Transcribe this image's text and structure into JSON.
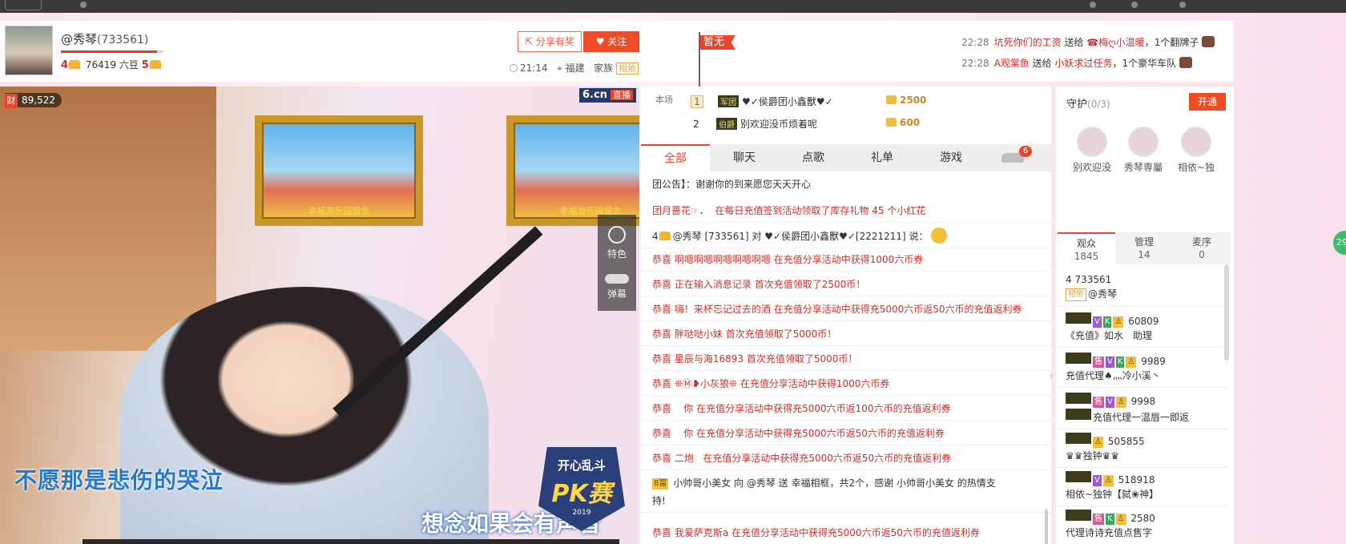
{
  "anchor": {
    "name": "@秀琴",
    "room_id": "(733561)",
    "level_left": "4",
    "beans": "76419 六豆",
    "level_right": "5"
  },
  "header": {
    "share_label": "分享有奖",
    "follow_label": "关注",
    "time": "21:14",
    "location": "福建",
    "family_label": "家族",
    "family_tag": "相依",
    "flag_label": "暂无"
  },
  "news": [
    {
      "time": "22:28",
      "from": "坑死你们的工资",
      "action": "送给",
      "to": "☎梅ღ小温暖",
      "gift": "1个翻牌子"
    },
    {
      "time": "22:28",
      "from": "A观棠鱼",
      "action": "送给",
      "to": "小妖求过任务",
      "gift": "1个豪华车队"
    }
  ],
  "video": {
    "heat_icon": "财",
    "heat": "89,522",
    "logo": "6.cn",
    "live": "直播",
    "frame_caption": "幸福游乐园留念",
    "tool_special": "特色",
    "tool_danmu": "弹幕",
    "switch_state": "OFF",
    "lyric1": "不愿那是悲伤的哭泣",
    "lyric2": "想念如果会有声音",
    "pk_top": "开心乱斗",
    "pk_main": "PK赛",
    "pk_year": "2019"
  },
  "ranking": {
    "label": "本场",
    "rows": [
      {
        "rank": "1",
        "tag": "军团",
        "name": "♥✓侯爵团小鑫獸♥✓",
        "gold": "2500"
      },
      {
        "rank": "2",
        "tag": "伯爵",
        "name": "别欢迎没币烦着呢",
        "gold": "600"
      }
    ]
  },
  "chat_tabs": [
    "全部",
    "聊天",
    "点歌",
    "礼单",
    "游戏"
  ],
  "car_count": "6",
  "notice": "团公告】：谢谢你的到来愿您天天开心",
  "chat": [
    {
      "a": "团月蔷花☞",
      "b": "．",
      "c": "在每日充值签到活动领取了库存礼物 45 个小红花"
    },
    {
      "a": "4",
      "b": "@秀琴 [733561] 对 ♥✓侯爵团小鑫獸♥✓[2221211] 说：",
      "c": ""
    },
    {
      "a": "恭喜",
      "b": "啊嗯啊嗯啊嗯啊嗯啊嗯",
      "c": "在充值分享活动中获得1000六币券"
    },
    {
      "a": "恭喜",
      "b": "正在输入消息记录",
      "c": "首次充值领取了2500币！"
    },
    {
      "a": "恭喜",
      "b": "嗨！来杯忘记过去的酒",
      "c": "在充值分享活动中获得充5000六币返50六币的充值返利券"
    },
    {
      "a": "恭喜",
      "b": "胖哒哒小妹",
      "c": "首次充值领取了5000币！"
    },
    {
      "a": "恭喜",
      "b": "星辰与海16893",
      "c": "首次充值领取了5000币！"
    },
    {
      "a": "恭喜",
      "b": "❊Ⓜ❥小灰狼❊",
      "c": "在充值分享活动中获得1000六币券"
    },
    {
      "a": "恭喜",
      "b": "你",
      "c": "在充值分享活动中获得充5000六币返100六币的充值返利券"
    },
    {
      "a": "恭喜",
      "b": "你",
      "c": "在充值分享活动中获得充5000六币返50六币的充值返利券"
    },
    {
      "a": "恭喜",
      "b": "二炮",
      "c": "在充值分享活动中获得充5000六币返50六币的充值返利券"
    },
    {
      "a": "8富",
      "b": "小帅哥小美女",
      "c": "向 @秀琴 送 幸福相框，共2个，感谢 小帅哥小美女 的热情支"
    },
    {
      "a": "持!",
      "b": "",
      "c": ""
    },
    {
      "a": "恭喜",
      "b": "我爱萨克斯a",
      "c": "在充值分享活动中获得充5000六币返50六币的充值返利券"
    }
  ],
  "guard": {
    "title": "守护",
    "count": "(0/3)",
    "open_label": "开通",
    "members": [
      "别欢迎没",
      "秀琴専屬",
      "相依~独"
    ]
  },
  "user_tabs": [
    {
      "label": "观众",
      "count": "1845"
    },
    {
      "label": "管理",
      "count": "14"
    },
    {
      "label": "麦序",
      "count": "0"
    }
  ],
  "users": [
    {
      "line1": "4 733561",
      "line2": "@秀琴"
    },
    {
      "line1": "60809",
      "line2": "《充值》如水　助理"
    },
    {
      "line1": "9989",
      "line2": "充值代理♠灬冷小溪丶"
    },
    {
      "line1": "9998",
      "line2": "充值代理一温唇一即返"
    },
    {
      "line1": "505855",
      "line2": "♛♛独钟♛♛"
    },
    {
      "line1": "518918",
      "line2": "相依~独钟【弑❀神】"
    },
    {
      "line1": "2580",
      "line2": "代理诗诗充值点售字"
    }
  ],
  "float_badge": "29"
}
